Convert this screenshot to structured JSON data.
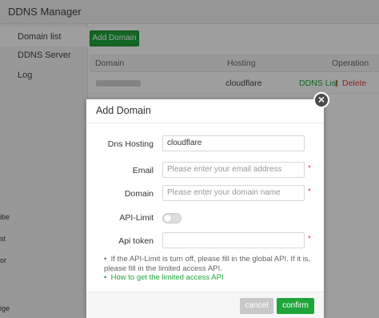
{
  "window": {
    "title": "DDNS Manager"
  },
  "sidebar": {
    "items": [
      {
        "label": "Domain list"
      },
      {
        "label": "DDNS Server"
      },
      {
        "label": "Log"
      }
    ]
  },
  "main": {
    "add_button": "Add Domain",
    "table": {
      "headers": {
        "domain": "Domain",
        "hosting": "Hosting",
        "operation": "Operation"
      },
      "rows": [
        {
          "hosting": "cloudflare",
          "list_link": "DDNS List",
          "separator": "|",
          "delete_link": "Delete"
        }
      ]
    }
  },
  "background_fragments": [
    "ibe",
    "st",
    "or",
    "ige"
  ],
  "modal": {
    "title": "Add Domain",
    "close_glyph": "×",
    "fields": {
      "dns_hosting": {
        "label": "Dns Hosting",
        "value": "cloudflare"
      },
      "email": {
        "label": "Email",
        "placeholder": "Please enter your email address",
        "required_mark": "*"
      },
      "domain": {
        "label": "Domain",
        "placeholder": "Please enter your domain name",
        "required_mark": "*"
      },
      "api_limit": {
        "label": "API-Limit",
        "enabled": false
      },
      "api_token": {
        "label": "Api token",
        "value": "",
        "required_mark": "*"
      }
    },
    "tips": {
      "note": "If the API-Limit is turn off, please fill in the global API. If it is, please fill in the limited access API.",
      "link": "How to get the limited access API"
    },
    "buttons": {
      "cancel": "cancel",
      "confirm": "confirm"
    }
  },
  "colors": {
    "accent_green": "#20a53a",
    "delete_red": "#e23e3e"
  }
}
